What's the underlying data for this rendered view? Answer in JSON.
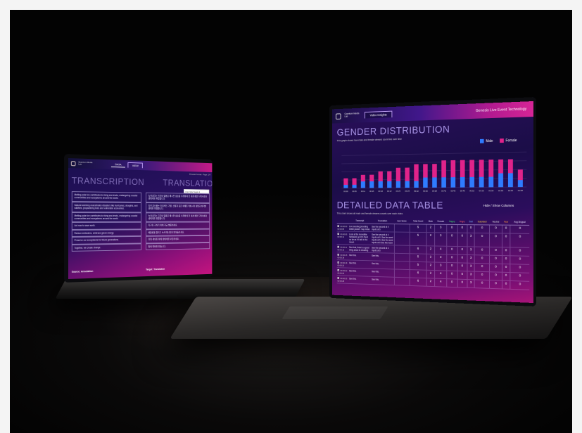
{
  "small_screen": {
    "brand": "Quantum Media Lab",
    "tabs": [
      {
        "label": "DATA"
      },
      {
        "label": "VIEW"
      }
    ],
    "preview_text": "Preview Format · Page: 1/4",
    "transcription_title": "TRANSCRIPTION",
    "translation_title": "TRANSLATION",
    "font_button_label": "Font Size Toggle ▾",
    "transcription_rows": [
      "Melting polar ice contributes to rising sea levels, endangering coastal communities and ecosystems around the world.",
      "Natural warming exacerbates disasters like hurricanes, droughts, and wildfires, jeopardizing lives and vulnerable economies.",
      "Melting polar ice contributes to rising sea levels, endangering coastal communities and ecosystems around the world.",
      "Act now to save earth.",
      "Reduce emissions, embrace green energy.",
      "Preserve our ecosystems for future generations.",
      "Together, we create change."
    ],
    "translation_rows": [
      "녹아내리는 극지방 얼음은 해수면 상승을 초래하여 전 세계 해안 지역사회와 생태계를 위협합니다.",
      "자연 온난화는 허리케인, 가뭄, 산불과 같은 재해를 악화시켜 생명과 취약한 경제를 위협합니다.",
      "녹아내리는 극지방 얼음은 해수면 상승을 초래하여 전 세계 해안 지역사회와 생태계를 위협합니다.",
      "지구를 구하기 위해 지금 행동하세요.",
      "배출량을 줄이고 녹색 에너지를 받아들이세요.",
      "미래 세대를 위해 생태계를 보존하세요.",
      "함께 변화를 만듭니다."
    ],
    "source_label": "Source: Annotation",
    "target_label": "Target: Translation"
  },
  "big_screen": {
    "brand": "Quantum Media Lab",
    "tab_label": "Video Insights",
    "app_title": "Genesis Live Event Technology",
    "chart_title": "GENDER DISTRIBUTION",
    "chart_subtitle": "This graph shows how male and female viewers count line over time",
    "legend": [
      {
        "label": "Male",
        "color": "#2f7bff"
      },
      {
        "label": "Female",
        "color": "#e0238a"
      }
    ],
    "table_title": "DETAILED DATA TABLE",
    "table_subtitle": "This chart shows all male and female viewers counts over each video",
    "toggle_columns": "Hide / Show Columns",
    "columns": [
      "",
      "Transcript",
      "Translation",
      "Gen Score",
      "Total Count",
      "Male",
      "Female",
      "Happy",
      "Angry",
      "Sad",
      "Surprised",
      "Neutral",
      "Fear",
      "Avg Disgust"
    ],
    "rows": [
      {
        "time": "00:00:00 00:00:05",
        "transcript": "Live seeding providing better picture. Say mean.",
        "translation": "See the second at 4 inputs at 6",
        "vals": [
          "",
          "5",
          "2",
          "3",
          "0",
          "0",
          "0",
          "0",
          "0",
          "0",
          "0"
        ]
      },
      {
        "time": "00:00:05 00:00:11",
        "transcript": "Look at the incredible hardware and it's fresh as far as if I talk in the mood.",
        "translation": "See the second at 4 inputs at 6, See the word inputs at 5, See the word inputs at 6 See the word",
        "vals": [
          "",
          "5",
          "2",
          "3",
          "0",
          "0",
          "3",
          "0",
          "0",
          "0",
          "0"
        ]
      },
      {
        "time": "00:00:11 00:00:15",
        "transcript": "See that, there's a good thing about to showing.",
        "translation": "See the second at 4 inputs at 6",
        "vals": [
          "",
          "6",
          "2",
          "4",
          "0",
          "0",
          "3",
          "0",
          "0",
          "0",
          "0"
        ]
      },
      {
        "time": "00:00:15 00:00:18",
        "transcript": "See this.",
        "translation": "See this.",
        "vals": [
          "",
          "5",
          "2",
          "3",
          "0",
          "0",
          "3",
          "0",
          "0",
          "0",
          "0"
        ]
      },
      {
        "time": "00:00:18 00:00:22",
        "transcript": "See this.",
        "translation": "See this.",
        "vals": [
          "",
          "5",
          "2",
          "3",
          "0",
          "0",
          "3",
          "0",
          "0",
          "0",
          "0"
        ]
      },
      {
        "time": "00:00:22 00:00:25",
        "transcript": "See this.",
        "translation": "See this.",
        "vals": [
          "",
          "6",
          "2",
          "4",
          "0",
          "0",
          "3",
          "0",
          "0",
          "0",
          "0"
        ]
      },
      {
        "time": "00:00:25 00:00:28",
        "transcript": "See this.",
        "translation": "See this.",
        "vals": [
          "",
          "6",
          "2",
          "4",
          "0",
          "0",
          "3",
          "0",
          "0",
          "0",
          "0"
        ]
      }
    ]
  },
  "chart_data": {
    "type": "bar",
    "title": "GENDER DISTRIBUTION",
    "categories": [
      "00:00",
      "00:05",
      "00:11",
      "00:15",
      "00:18",
      "00:22",
      "00:25",
      "00:28",
      "00:32",
      "00:35",
      "00:38",
      "00:42",
      "00:45",
      "00:48",
      "00:52",
      "00:55",
      "00:58",
      "01:02",
      "01:05",
      "01:08"
    ],
    "series": [
      {
        "name": "Male",
        "values": [
          1,
          1,
          2,
          2,
          2,
          2,
          2,
          2,
          2,
          3,
          3,
          3,
          3,
          3,
          3,
          3,
          3,
          4,
          4,
          2
        ]
      },
      {
        "name": "Female",
        "values": [
          2,
          2,
          2,
          2,
          3,
          3,
          4,
          4,
          5,
          4,
          4,
          5,
          5,
          5,
          5,
          5,
          5,
          4,
          4,
          3
        ]
      }
    ],
    "ylim": [
      0,
      10
    ],
    "stacked": true,
    "grid": true,
    "legend": "top-right"
  }
}
